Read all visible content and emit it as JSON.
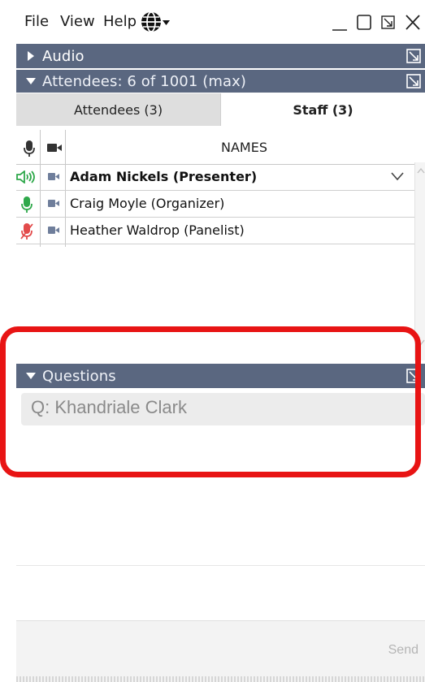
{
  "menu": {
    "file": "File",
    "view": "View",
    "help": "Help"
  },
  "audio_panel": {
    "title": "Audio"
  },
  "attendees_panel": {
    "title": "Attendees:  6 of 1001 (max)",
    "tabs": [
      {
        "label": "Attendees (3)",
        "active": false
      },
      {
        "label": "Staff (3)",
        "active": true
      }
    ],
    "names_header": "NAMES",
    "rows": [
      {
        "name": "Adam Nickels (Presenter)",
        "bold": true,
        "mic": "speaking"
      },
      {
        "name": "Craig Moyle (Organizer)",
        "bold": false,
        "mic": "on"
      },
      {
        "name": "Heather Waldrop (Panelist)",
        "bold": false,
        "mic": "muted"
      }
    ]
  },
  "questions_panel": {
    "title": "Questions",
    "question": "Q: Khandriale Clark",
    "send_label": "Send"
  },
  "colors": {
    "header_bg": "#5a6780",
    "mic_green": "#2ea84a",
    "mic_muted": "#e24b4b",
    "camera": "#6f7e9b",
    "annotation": "#e81414"
  },
  "icons": [
    "globe-icon",
    "minimize-icon",
    "maximize-icon",
    "restore-icon",
    "close-icon",
    "microphone-icon",
    "camera-icon",
    "popout-icon",
    "chevron-down-icon"
  ]
}
